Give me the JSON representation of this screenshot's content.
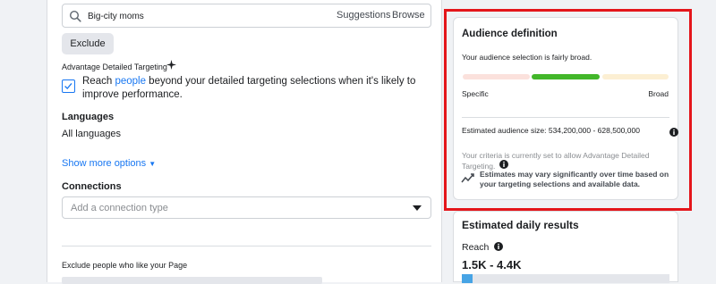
{
  "search": {
    "value": "Big-city moms",
    "suggestions_label": "Suggestions",
    "browse_label": "Browse"
  },
  "exclude_button": "Exclude",
  "advantage": {
    "title": "Advantage Detailed Targeting",
    "text_before": "Reach ",
    "link_text": "people",
    "text_after": " beyond your detailed targeting selections when it's likely to improve performance.",
    "checked": true
  },
  "languages": {
    "heading": "Languages",
    "value": "All languages"
  },
  "show_more": "Show more options",
  "connections": {
    "heading": "Connections",
    "placeholder": "Add a connection type"
  },
  "exclude_like_label": "Exclude people who like your Page",
  "audience_definition": {
    "title": "Audience definition",
    "subtitle": "Your audience selection is fairly broad.",
    "scale_left": "Specific",
    "scale_right": "Broad",
    "level": "fairly broad",
    "estimated_size_label": "Estimated audience size: 534,200,000 - 628,500,000",
    "criteria_text": "Your criteria is currently set to allow Advantage Detailed Targeting.",
    "estimates_note": "Estimates may vary significantly over time based on your targeting selections and available data."
  },
  "daily_results": {
    "title": "Estimated daily results",
    "reach_label": "Reach",
    "reach_value": "1.5K - 4.4K",
    "reach_fraction": 0.05
  },
  "colors": {
    "accent_blue": "#1877f2",
    "highlight_red": "#e4161b",
    "meter_green": "#42b72a",
    "meter_pink": "#fbe1dc",
    "meter_yellow": "#fcefd3"
  }
}
